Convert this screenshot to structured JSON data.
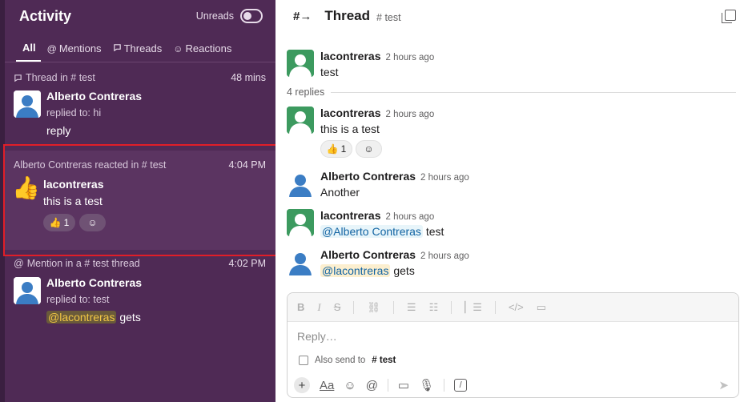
{
  "activity": {
    "title": "Activity",
    "unreads_label": "Unreads",
    "tabs": [
      {
        "label": "All"
      },
      {
        "label": "Mentions",
        "icon": "@"
      },
      {
        "label": "Threads",
        "icon": "thread-icon"
      },
      {
        "label": "Reactions",
        "icon": "smiley-icon"
      }
    ],
    "notifications": [
      {
        "meta": "Thread in # test",
        "time": "48 mins",
        "name": "Alberto Contreras",
        "sub": "replied to: hi",
        "text": "reply"
      },
      {
        "meta": "Alberto Contreras reacted in # test",
        "time": "4:04 PM",
        "emoji": "👍",
        "name": "lacontreras",
        "text": "this is a test",
        "reaction_count": "1"
      },
      {
        "meta": "Mention in a # test thread",
        "time": "4:02 PM",
        "name": "Alberto Contreras",
        "sub": "replied to: test",
        "mention": "@lacontreras",
        "text_after": " gets"
      }
    ]
  },
  "thread": {
    "title": "Thread",
    "channel": "# test",
    "parent": {
      "author": "lacontreras",
      "time": "2 hours ago",
      "text": "test"
    },
    "replies_label": "4 replies",
    "replies": [
      {
        "author": "lacontreras",
        "time": "2 hours ago",
        "text": "this is a test",
        "reaction_count": "1"
      },
      {
        "author": "Alberto Contreras",
        "time": "2 hours ago",
        "text": "Another"
      },
      {
        "author": "lacontreras",
        "time": "2 hours ago",
        "mention": "@Alberto Contreras",
        "text_after": " test"
      },
      {
        "author": "Alberto Contreras",
        "time": "2 hours ago",
        "mention": "@lacontreras",
        "text_after": " gets"
      }
    ],
    "composer": {
      "placeholder": "Reply…",
      "also_send_prefix": "Also send to",
      "also_send_channel": "# test",
      "format_label": "Aa"
    }
  },
  "colors": {
    "sidebar_bg": "#4f2a55",
    "highlight_border": "#e01e28",
    "link_blue": "#1264a3"
  }
}
